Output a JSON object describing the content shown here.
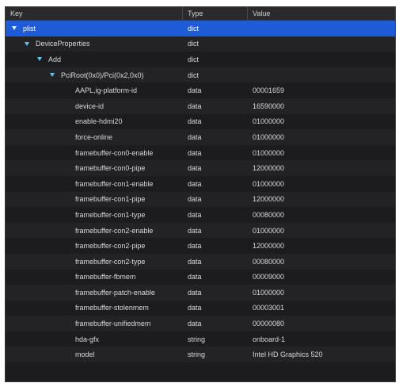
{
  "header": {
    "key": "Key",
    "type": "Type",
    "value": "Value"
  },
  "rows": [
    {
      "key": "plist",
      "type": "dict",
      "value": ""
    },
    {
      "key": "DeviceProperties",
      "type": "dict",
      "value": ""
    },
    {
      "key": "Add",
      "type": "dict",
      "value": ""
    },
    {
      "key": "PciRoot(0x0)/Pci(0x2,0x0)",
      "type": "dict",
      "value": ""
    },
    {
      "key": "AAPL,ig-platform-id",
      "type": "data",
      "value": "00001659"
    },
    {
      "key": "device-id",
      "type": "data",
      "value": "16590000"
    },
    {
      "key": "enable-hdmi20",
      "type": "data",
      "value": "01000000"
    },
    {
      "key": "force-online",
      "type": "data",
      "value": "01000000"
    },
    {
      "key": "framebuffer-con0-enable",
      "type": "data",
      "value": "01000000"
    },
    {
      "key": "framebuffer-con0-pipe",
      "type": "data",
      "value": "12000000"
    },
    {
      "key": "framebuffer-con1-enable",
      "type": "data",
      "value": "01000000"
    },
    {
      "key": "framebuffer-con1-pipe",
      "type": "data",
      "value": "12000000"
    },
    {
      "key": "framebuffer-con1-type",
      "type": "data",
      "value": "00080000"
    },
    {
      "key": "framebuffer-con2-enable",
      "type": "data",
      "value": "01000000"
    },
    {
      "key": "framebuffer-con2-pipe",
      "type": "data",
      "value": "12000000"
    },
    {
      "key": "framebuffer-con2-type",
      "type": "data",
      "value": "00080000"
    },
    {
      "key": "framebuffer-fbmem",
      "type": "data",
      "value": "00009000"
    },
    {
      "key": "framebuffer-patch-enable",
      "type": "data",
      "value": "01000000"
    },
    {
      "key": "framebuffer-stolenmem",
      "type": "data",
      "value": "00003001"
    },
    {
      "key": "framebuffer-unifiedmem",
      "type": "data",
      "value": "00000080"
    },
    {
      "key": "hda-gfx",
      "type": "string",
      "value": "onboard-1"
    },
    {
      "key": "model",
      "type": "string",
      "value": "Intel HD Graphics 520"
    }
  ],
  "colors": {
    "selection": "#1e5bd6",
    "disclosure": "#5ec3f0"
  },
  "icons": {
    "disclosure": "disclosure-triangle-down-icon"
  }
}
